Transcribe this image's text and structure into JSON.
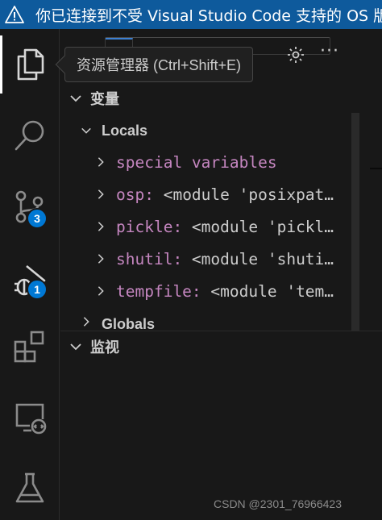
{
  "banner": {
    "text": "你已连接到不受 Visual Studio Code 支持的 OS 版本。"
  },
  "activity": {
    "source_control_badge": "3",
    "run_debug_badge": "1"
  },
  "tooltip": {
    "text": "资源管理器 (Ctrl+Shift+E)"
  },
  "header": {
    "more_label": "···"
  },
  "variables": {
    "title": "变量",
    "locals": {
      "label": "Locals",
      "items": [
        {
          "name": "special variables",
          "value": ""
        },
        {
          "name": "osp:",
          "value": " <module 'posixpat…"
        },
        {
          "name": "pickle:",
          "value": " <module 'pickl…"
        },
        {
          "name": "shutil:",
          "value": " <module 'shuti…"
        },
        {
          "name": "tempfile:",
          "value": " <module 'tem…"
        }
      ]
    },
    "globals": {
      "label": "Globals"
    }
  },
  "watch": {
    "title": "监视"
  },
  "watermark": "CSDN @2301_76966423",
  "colors": {
    "banner": "#0e5a9c",
    "badge": "#0078d4",
    "var_name": "#c586c0",
    "background": "#181818"
  }
}
